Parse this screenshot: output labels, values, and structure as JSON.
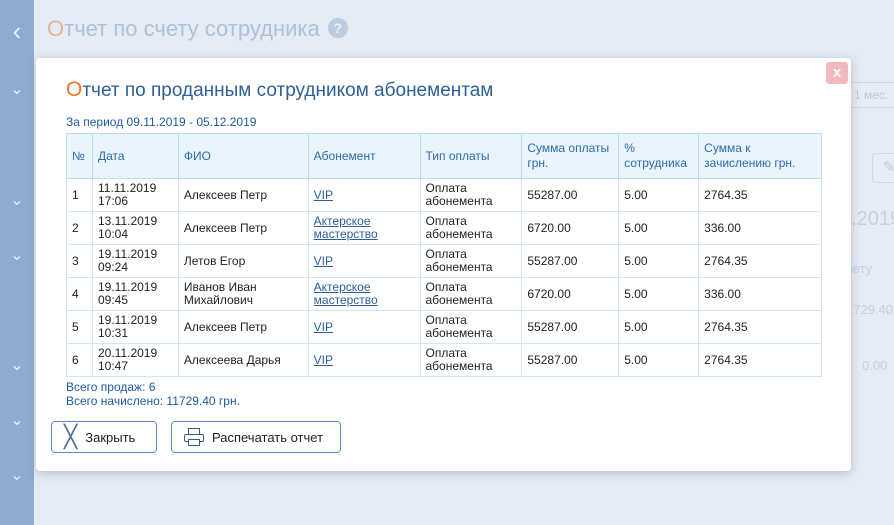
{
  "background": {
    "title_first_letter": "О",
    "title_rest": "тчет по счету сотрудника",
    "help_icon": "?",
    "range_label": "1 мес.",
    "date_fragment": "2.2019",
    "column_fragment": "чету",
    "value1": "1729.40",
    "value2": "0.00"
  },
  "sidebar": {
    "back_icon": "‹",
    "expand_icon": "⌄"
  },
  "modal": {
    "close_symbol": "x",
    "title_first_letter": "О",
    "title_rest": "тчет по проданным сотрудником абонементам",
    "period": "За период 09.11.2019 - 05.12.2019",
    "headers": {
      "no": "№",
      "date": "Дата",
      "fio": "ФИО",
      "subscription": "Абонемент",
      "payment_type": "Тип оплаты",
      "amount": "Сумма оплаты грн.",
      "percent": "% сотрудника",
      "accrual": "Сумма к зачислению грн."
    },
    "rows": [
      {
        "no": "1",
        "date": "11.11.2019",
        "time": "17:06",
        "fio": "Алексеев Петр",
        "subscription": "VIP",
        "payment_type": "Оплата абонемента",
        "amount": "55287.00",
        "percent": "5.00",
        "accrual": "2764.35"
      },
      {
        "no": "2",
        "date": "13.11.2019",
        "time": "10:04",
        "fio": "Алексеев Петр",
        "subscription": "Актерское мастерство",
        "payment_type": "Оплата абонемента",
        "amount": "6720.00",
        "percent": "5.00",
        "accrual": "336.00"
      },
      {
        "no": "3",
        "date": "19.11.2019",
        "time": "09:24",
        "fio": "Летов Егор",
        "subscription": "VIP",
        "payment_type": "Оплата абонемента",
        "amount": "55287.00",
        "percent": "5.00",
        "accrual": "2764.35"
      },
      {
        "no": "4",
        "date": "19.11.2019",
        "time": "09:45",
        "fio": "Иванов Иван Михайлович",
        "subscription": "Актерское мастерство",
        "payment_type": "Оплата абонемента",
        "amount": "6720.00",
        "percent": "5.00",
        "accrual": "336.00"
      },
      {
        "no": "5",
        "date": "19.11.2019",
        "time": "10:31",
        "fio": "Алексеев Петр",
        "subscription": "VIP",
        "payment_type": "Оплата абонемента",
        "amount": "55287.00",
        "percent": "5.00",
        "accrual": "2764.35"
      },
      {
        "no": "6",
        "date": "20.11.2019",
        "time": "10:47",
        "fio": "Алексеева Дарья",
        "subscription": "VIP",
        "payment_type": "Оплата абонемента",
        "amount": "55287.00",
        "percent": "5.00",
        "accrual": "2764.35"
      }
    ],
    "total_sales": "Всего продаж: 6",
    "total_accrued": "Всего начислено: 11729.40 грн.",
    "close_button": "Закрыть",
    "print_button": "Распечатать отчет"
  }
}
